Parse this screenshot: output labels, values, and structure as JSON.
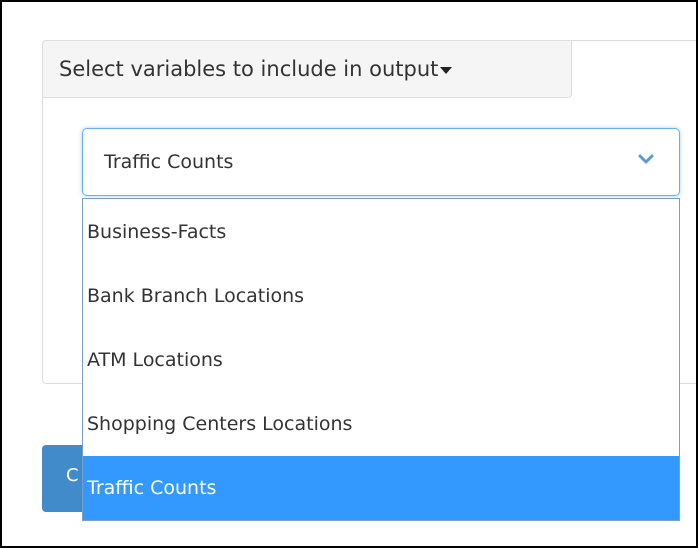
{
  "panel": {
    "toggle_label": "Select variables to include in output"
  },
  "select": {
    "value": "Traffic Counts",
    "options": [
      "Business-Facts",
      "Bank Branch Locations",
      "ATM Locations",
      "Shopping Centers Locations",
      "Traffic Counts"
    ],
    "selected_index": 4
  },
  "button": {
    "label_partial": "C"
  },
  "colors": {
    "highlight": "#3399ff",
    "button": "#428bca",
    "focus_border": "#66afe9"
  },
  "icons": {
    "select_arrow": "chevron-down-icon",
    "toggle_arrow": "caret-down-icon"
  }
}
